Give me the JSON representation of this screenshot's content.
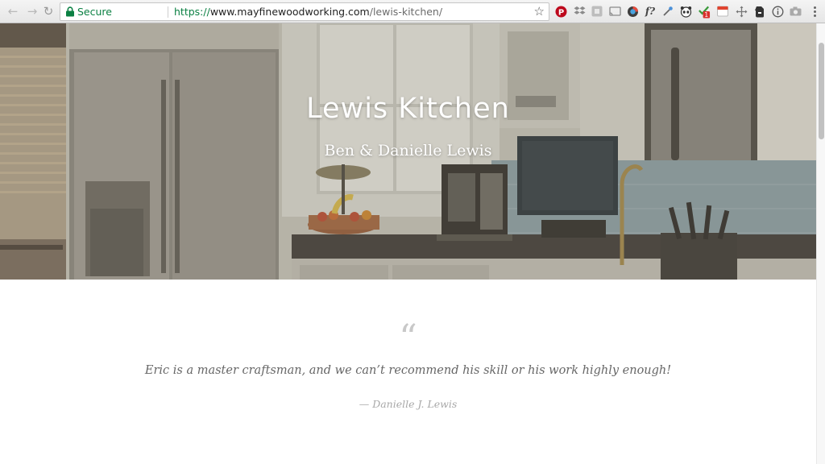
{
  "browser": {
    "security_label": "Secure",
    "url": {
      "scheme": "https://",
      "host": "www.mayfinewoodworking.com",
      "path": "/lewis-kitchen/"
    },
    "extension_badge": "1",
    "extensions": [
      "pinterest-icon",
      "dropbox-icon",
      "screenshot-icon",
      "cast-icon",
      "color-picker-icon",
      "font-finder-icon",
      "eyedropper-icon",
      "panda-icon",
      "checklist-icon",
      "calendar-icon",
      "move-icon",
      "evernote-icon",
      "info-icon",
      "camera-icon",
      "menu-icon"
    ],
    "font_finder_label": "f?",
    "colors": {
      "secure": "#0b8043",
      "pinterest": "#bd081c"
    }
  },
  "hero": {
    "title": "Lewis Kitchen",
    "subtitle": "Ben & Danielle Lewis"
  },
  "testimonial": {
    "quote_mark": "“",
    "text": "Eric is a master craftsman, and we can’t recommend his skill or his work highly enough!",
    "citation": "— Danielle J. Lewis"
  }
}
